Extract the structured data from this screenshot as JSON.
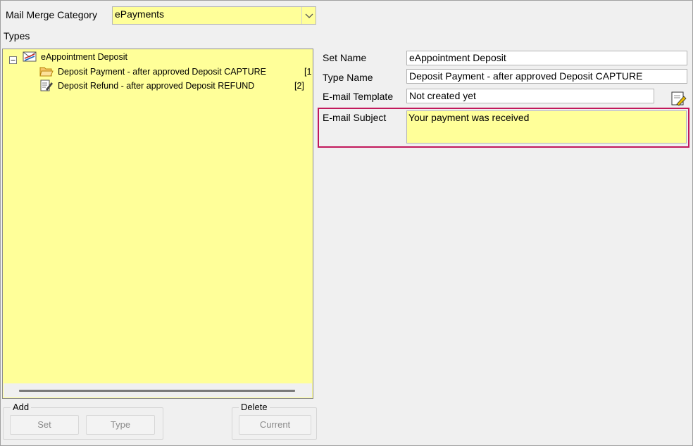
{
  "category": {
    "label": "Mail Merge Category",
    "value": "ePayments"
  },
  "types_label": "Types",
  "tree": {
    "root": {
      "label": "eAppointment Deposit",
      "icon": "mail-set-icon"
    },
    "children": [
      {
        "label": "Deposit Payment - after approved Deposit CAPTURE",
        "count": "[1",
        "icon": "open-folder-icon"
      },
      {
        "label": "Deposit Refund - after approved Deposit REFUND",
        "count": "[2]",
        "icon": "edit-document-icon"
      }
    ]
  },
  "form": {
    "set_name_label": "Set Name",
    "set_name_value": "eAppointment Deposit",
    "type_name_label": "Type Name",
    "type_name_value": "Deposit Payment - after approved Deposit CAPTURE",
    "template_label": "E-mail Template",
    "template_value": "Not created yet",
    "subject_label": "E-mail Subject",
    "subject_value": "Your payment was received"
  },
  "add_group": {
    "title": "Add",
    "set_label": "Set",
    "type_label": "Type"
  },
  "delete_group": {
    "title": "Delete",
    "current_label": "Current"
  },
  "colors": {
    "field_highlight": "#ffff99",
    "selection_border": "#c2185b"
  }
}
